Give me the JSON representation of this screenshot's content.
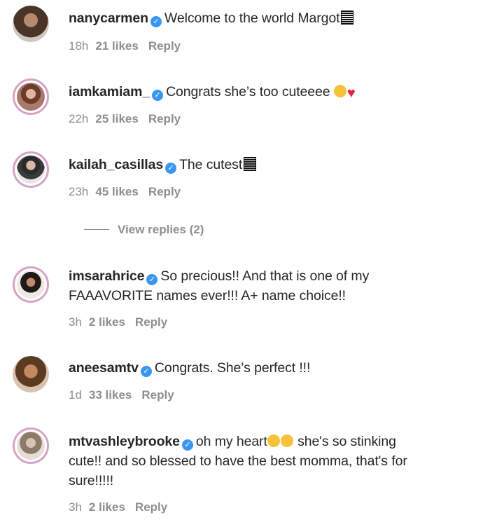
{
  "comments": [
    {
      "username": "nanycarmen",
      "text": "Welcome to the world Margot",
      "time": "18h",
      "likes": "21 likes",
      "reply": "Reply"
    },
    {
      "username": "iamkamiam_",
      "text": "Congrats she’s too cuteeee",
      "time": "22h",
      "likes": "25 likes",
      "reply": "Reply"
    },
    {
      "username": "kailah_casillas",
      "text": "The cutest",
      "time": "23h",
      "likes": "45 likes",
      "reply": "Reply"
    },
    {
      "username": "imsarahrice",
      "text_line1": "So precious!! And that is one of my",
      "text_line2": "FAAAVORITE names ever!!! A+ name choice!!",
      "time": "3h",
      "likes": "2 likes",
      "reply": "Reply"
    },
    {
      "username": "aneesamtv",
      "text": "Congrats. She’s perfect !!!",
      "time": "1d",
      "likes": "33 likes",
      "reply": "Reply"
    },
    {
      "username": "mtvashleybrooke",
      "text_line1a": "oh my heart",
      "text_line1b": "she's so stinking",
      "text_line2": "cute!! and so blessed to have the best momma, that's for",
      "text_line3": "sure!!!!!",
      "time": "3h",
      "likes": "2 likes",
      "reply": "Reply"
    }
  ],
  "view_replies": "View replies (2)",
  "colors": {
    "verified": "#3897f0",
    "meta": "#8e8e8e",
    "text": "#262626",
    "ring": "#d6a3c6"
  },
  "icons": [
    "verified-badge-icon",
    "barcode-emoji-icon",
    "heart-eyes-emoji-icon",
    "red-heart-emoji-icon",
    "grinning-sweat-emoji-icon"
  ]
}
